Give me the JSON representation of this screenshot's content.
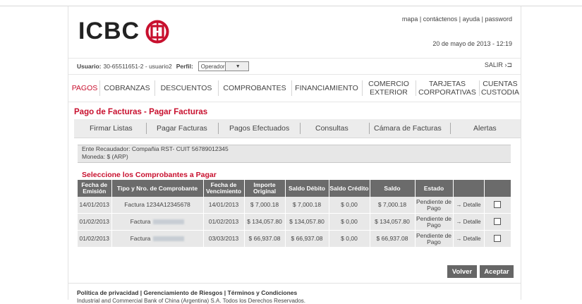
{
  "brand": {
    "name": "ICBC",
    "accent": "#c8102e"
  },
  "toplinks": "mapa | contáctenos | ayuda | password",
  "datetime": "20 de mayo de 2013 - 12:19",
  "user": {
    "usuario_label": "Usuario:",
    "usuario_value": "30-65511651-2  -  usuario2",
    "perfil_label": "Perfil:",
    "perfil_value": "Operador"
  },
  "salir": "SALIR",
  "nav": [
    {
      "label": "PAGOS"
    },
    {
      "label": "COBRANZAS"
    },
    {
      "label": "DESCUENTOS"
    },
    {
      "label": "COMPROBANTES"
    },
    {
      "label": "FINANCIAMIENTO"
    },
    {
      "label": "COMERCIO EXTERIOR"
    },
    {
      "label": "TARJETAS CORPORATIVAS"
    },
    {
      "label": "CUENTAS CUSTODIA"
    }
  ],
  "page_title": "Pago de Facturas - Pagar Facturas",
  "subnav": [
    {
      "label": "Firmar Listas"
    },
    {
      "label": "Pagar Facturas"
    },
    {
      "label": "Pagos Efectuados"
    },
    {
      "label": "Consultas"
    },
    {
      "label": "Cámara de Facturas"
    },
    {
      "label": "Alertas"
    }
  ],
  "info": {
    "recaudador": "Ente Recaudador:  Compañia RST- CUIT 56789012345",
    "moneda": "Moneda: $ (ARP)"
  },
  "section_title": "Seleccione los Comprobantes a Pagar",
  "table": {
    "headers": [
      "Fecha de Emisión",
      "Tipo y Nro. de Comprobante",
      "Fecha de Vencimiento",
      "Importe Original",
      "Saldo Débito",
      "Saldo Crédito",
      "Saldo",
      "Estado"
    ],
    "rows": [
      {
        "emision": "14/01/2013",
        "tipo": "Factura",
        "numero": "1234A12345678",
        "vencimiento": "14/01/2013",
        "importe": "$ 7,000.18",
        "debito": "$ 7,000.18",
        "credito": "$ 0,00",
        "saldo": "$ 7,000.18",
        "estado": "Pendiente de Pago",
        "detalle": "→ Detalle"
      },
      {
        "emision": "01/02/2013",
        "tipo": "Factura",
        "numero": "",
        "vencimiento": "01/02/2013",
        "importe": "$ 134,057.80",
        "debito": "$ 134,057.80",
        "credito": "$ 0,00",
        "saldo": "$ 134,057.80",
        "estado": "Pendiente de Pago",
        "detalle": "→ Detalle"
      },
      {
        "emision": "01/02/2013",
        "tipo": "Factura",
        "numero": "",
        "vencimiento": "03/03/2013",
        "importe": "$ 66,937.08",
        "debito": "$ 66,937.08",
        "credito": "$ 0,00",
        "saldo": "$ 66,937.08",
        "estado": "Pendiente de Pago",
        "detalle": "→ Detalle"
      }
    ]
  },
  "buttons": {
    "volver": "Volver",
    "aceptar": "Aceptar"
  },
  "footer": {
    "links": "Política de privacidad | Gerenciamiento de Riesgos | Términos y Condiciones",
    "copyright": "Industrial and Commercial Bank of China (Argentina) S.A. Todos los Derechos Reservados."
  }
}
